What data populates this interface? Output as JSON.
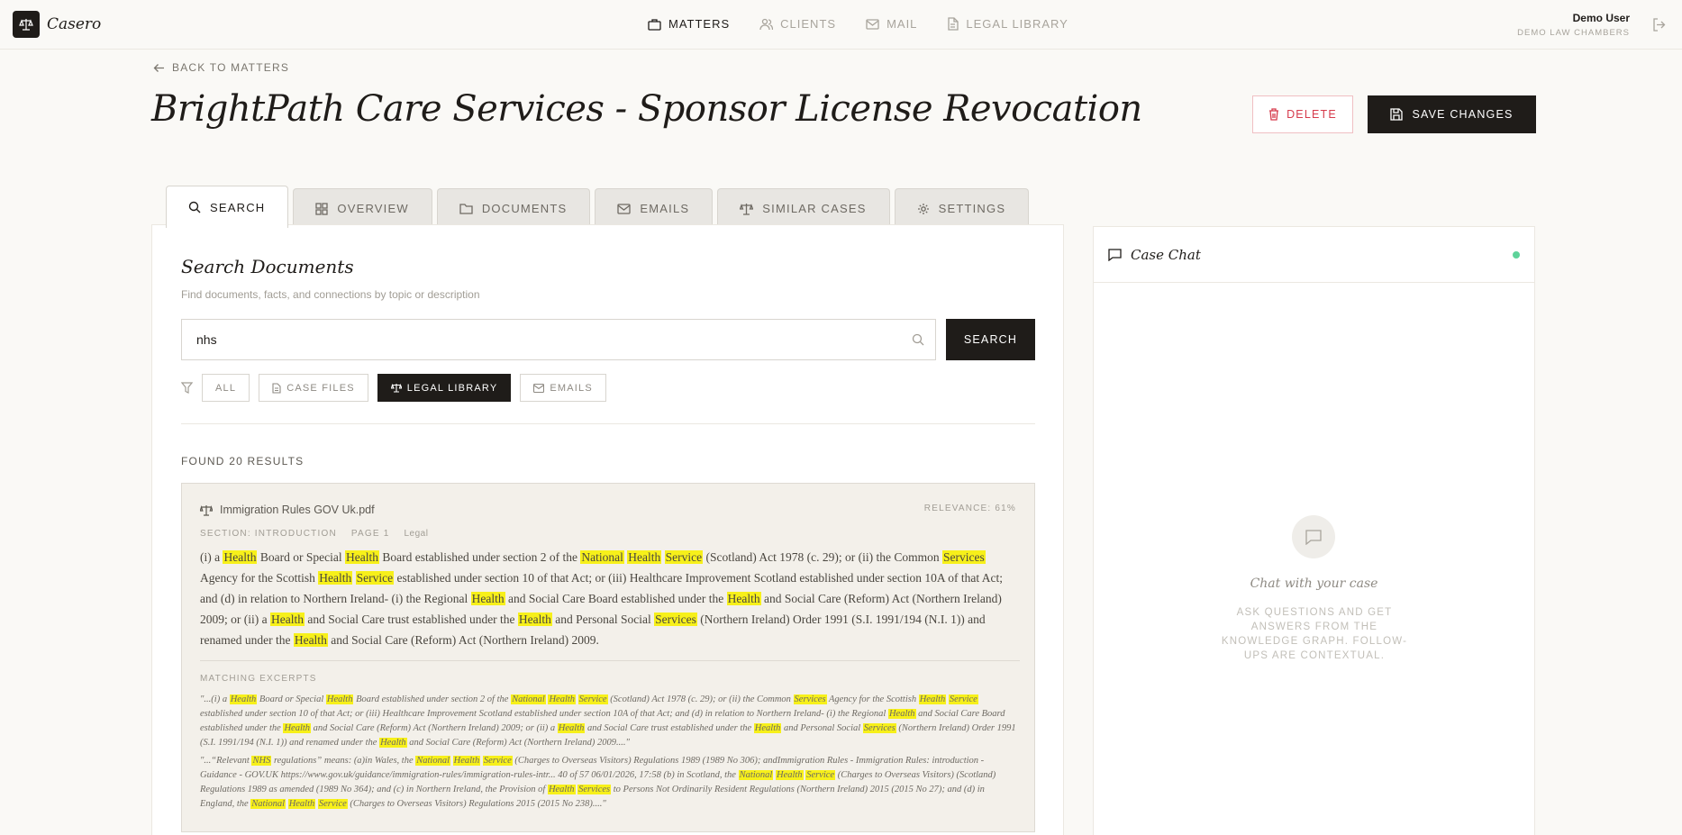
{
  "app": {
    "name": "Casero"
  },
  "nav": [
    {
      "label": "MATTERS",
      "icon": "briefcase-icon",
      "active": true
    },
    {
      "label": "CLIENTS",
      "icon": "users-icon",
      "active": false
    },
    {
      "label": "MAIL",
      "icon": "mail-icon",
      "active": false
    },
    {
      "label": "LEGAL LIBRARY",
      "icon": "document-icon",
      "active": false
    }
  ],
  "user": {
    "name": "Demo User",
    "org": "DEMO LAW CHAMBERS"
  },
  "header": {
    "back_label": "BACK TO MATTERS",
    "title": "BrightPath Care Services - Sponsor License Revocation",
    "delete_label": "DELETE",
    "save_label": "SAVE CHANGES"
  },
  "tabs": [
    {
      "label": "SEARCH",
      "icon": "search-icon",
      "active": true
    },
    {
      "label": "OVERVIEW",
      "icon": "grid-icon",
      "active": false
    },
    {
      "label": "DOCUMENTS",
      "icon": "folder-icon",
      "active": false
    },
    {
      "label": "EMAILS",
      "icon": "mail-icon",
      "active": false
    },
    {
      "label": "SIMILAR CASES",
      "icon": "scales-icon",
      "active": false
    },
    {
      "label": "SETTINGS",
      "icon": "gear-icon",
      "active": false
    }
  ],
  "search": {
    "title": "Search Documents",
    "subtitle": "Find documents, facts, and connections by topic or description",
    "query": "nhs",
    "button_label": "SEARCH",
    "filters": [
      {
        "label": "ALL",
        "active": false
      },
      {
        "label": "CASE FILES",
        "active": false
      },
      {
        "label": "LEGAL LIBRARY",
        "active": true
      },
      {
        "label": "EMAILS",
        "active": false
      }
    ],
    "results_count": "FOUND 20 RESULTS"
  },
  "result": {
    "file_name": "Immigration Rules GOV Uk.pdf",
    "relevance": "RELEVANCE: 61%",
    "section": "SECTION: INTRODUCTION",
    "page": "PAGE 1",
    "category": "Legal",
    "excerpts_label": "MATCHING EXCERPTS"
  },
  "chat": {
    "title": "Case Chat",
    "status_color": "#5ed39a",
    "empty_title": "Chat with your case",
    "empty_subtitle": "ASK QUESTIONS AND GET ANSWERS FROM THE KNOWLEDGE GRAPH. FOLLOW-UPS ARE CONTEXTUAL."
  },
  "colors": {
    "accent": "#1f1c19",
    "highlight": "#f7f01a",
    "danger": "#d63b4c"
  }
}
